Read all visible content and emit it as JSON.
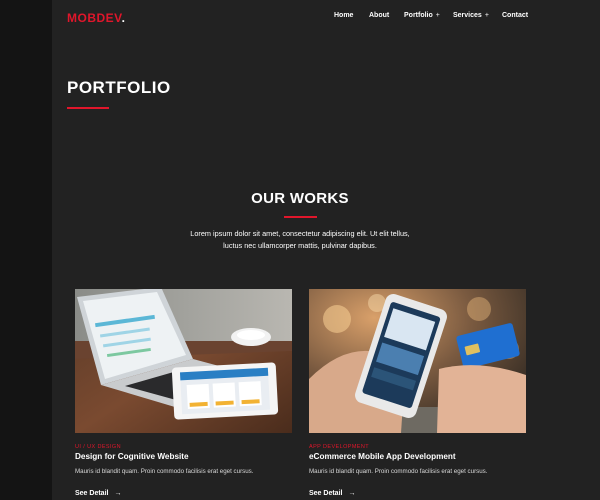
{
  "brand": {
    "name": "MOBDEV",
    "dot": "."
  },
  "nav": {
    "items": [
      {
        "label": "Home",
        "has_submenu": false
      },
      {
        "label": "About",
        "has_submenu": false
      },
      {
        "label": "Portfolio",
        "has_submenu": true,
        "submenu_icon": "+"
      },
      {
        "label": "Services",
        "has_submenu": true,
        "submenu_icon": "+"
      },
      {
        "label": "Contact",
        "has_submenu": false
      }
    ]
  },
  "hero": {
    "title": "PORTFOLIO"
  },
  "works": {
    "title": "OUR WORKS",
    "description": "Lorem ipsum dolor sit amet, consectetur adipiscing elit. Ut elit tellus, luctus nec ullamcorper mattis, pulvinar dapibus.",
    "cards": [
      {
        "category": "UI / UX DESIGN",
        "title": "Design for Cognitive Website",
        "text": "Mauris id blandit quam. Proin commodo facilisis erat eget cursus.",
        "link": "See Detail",
        "link_icon": "arrow-right-icon",
        "image": "laptop-and-tablet-photo"
      },
      {
        "category": "APP DEVELOPMENT",
        "title": "eCommerce Mobile App Development",
        "text": "Mauris id blandit quam. Proin commodo facilisis erat eget cursus.",
        "link": "See Detail",
        "link_icon": "arrow-right-icon",
        "image": "smartphone-shopping-photo"
      }
    ]
  },
  "colors": {
    "accent": "#e0162b",
    "background": "#222222",
    "text": "#ffffff"
  }
}
